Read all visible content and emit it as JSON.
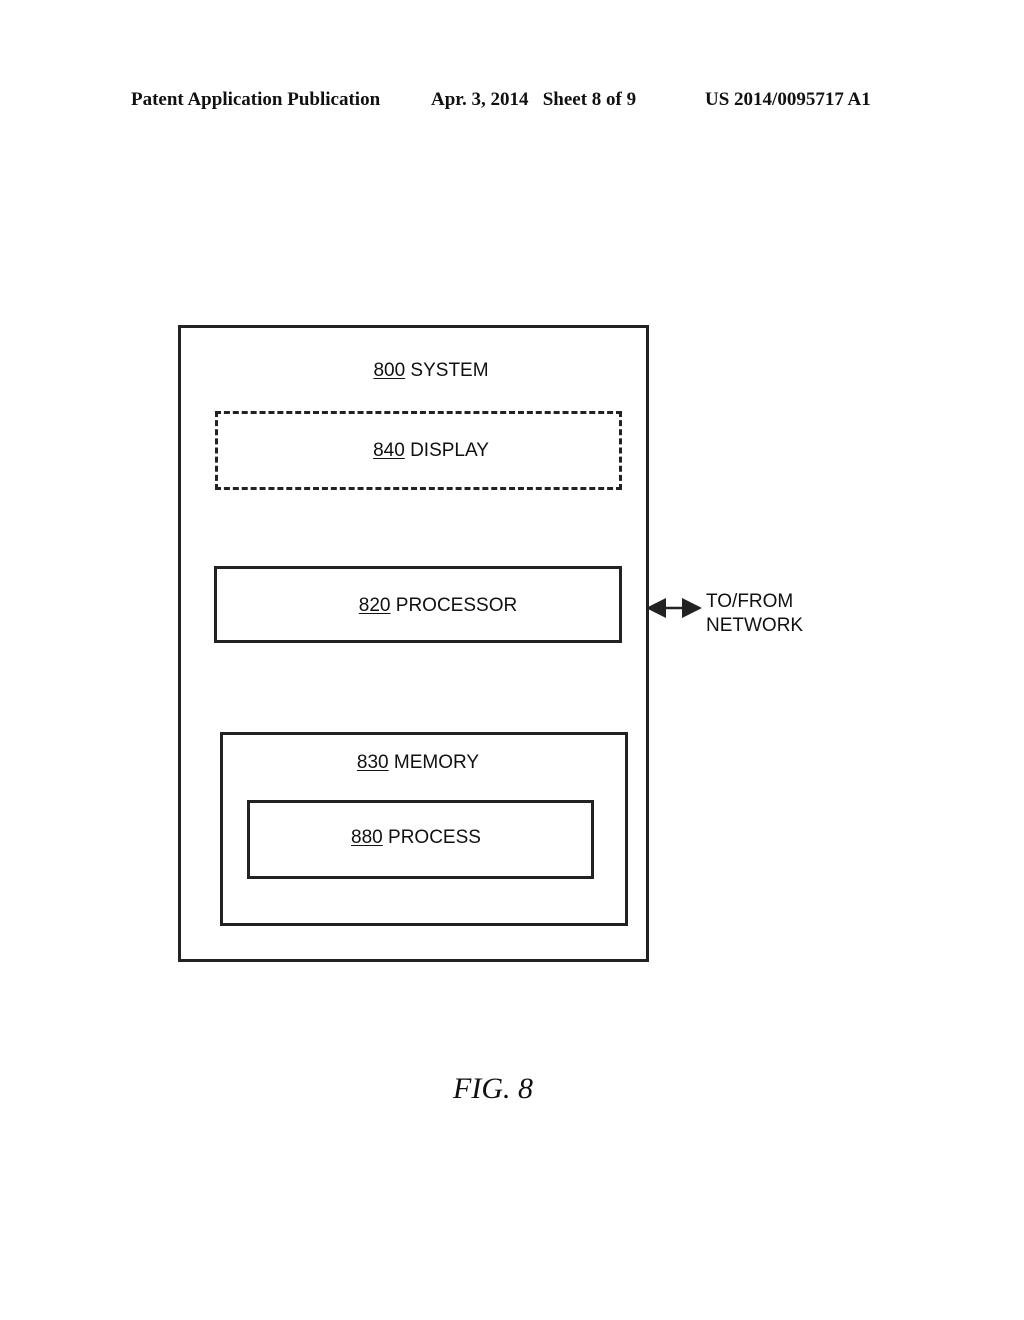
{
  "header": {
    "left": "Patent Application Publication",
    "middle": "Apr. 3, 2014   Sheet 8 of 9",
    "right": "US 2014/0095717 A1"
  },
  "diagram": {
    "system": {
      "number": "800",
      "label": "SYSTEM"
    },
    "display": {
      "number": "840",
      "label": "DISPLAY",
      "optional": true
    },
    "processor": {
      "number": "820",
      "label": "PROCESSOR"
    },
    "memory": {
      "number": "830",
      "label": "MEMORY"
    },
    "process": {
      "number": "880",
      "label": "PROCESS"
    },
    "network": {
      "line1": "TO/FROM",
      "line2": "NETWORK"
    }
  },
  "figure_caption": "FIG. 8"
}
